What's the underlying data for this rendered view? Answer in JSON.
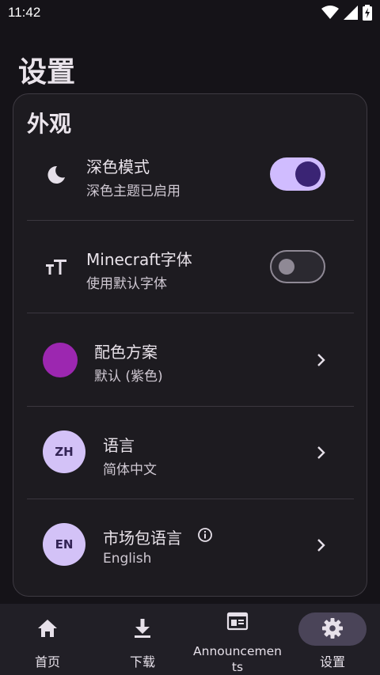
{
  "status_bar": {
    "time": "11:42",
    "icons": [
      "wifi-icon",
      "signal-icon",
      "battery-icon"
    ]
  },
  "page": {
    "title": "设置"
  },
  "appearance": {
    "section_title": "外观",
    "dark_mode": {
      "icon": "moon-icon",
      "title": "深色模式",
      "subtitle": "深色主题已启用",
      "enabled": true
    },
    "minecraft_font": {
      "icon": "text-size-icon",
      "title": "Minecraft字体",
      "subtitle": "使用默认字体",
      "enabled": false
    },
    "color_scheme": {
      "title": "配色方案",
      "subtitle": "默认 (紫色)",
      "swatch_color": "#9c27b0"
    },
    "language": {
      "badge": "ZH",
      "title": "语言",
      "subtitle": "简体中文"
    },
    "market_language": {
      "badge": "EN",
      "title": "市场包语言",
      "subtitle": "English",
      "info_icon": "info-icon"
    }
  },
  "bottom_nav": {
    "items": [
      {
        "icon": "home-icon",
        "label": "首页"
      },
      {
        "icon": "download-icon",
        "label": "下载"
      },
      {
        "icon": "announcements-icon",
        "label": "Announcements"
      },
      {
        "icon": "gear-icon",
        "label": "设置",
        "selected": true
      }
    ]
  },
  "colors": {
    "background": "#151318",
    "card": "#1d1b20",
    "accent": "#d0bcff",
    "accent_dark": "#3a2474",
    "badge": "#d3c2f7"
  }
}
